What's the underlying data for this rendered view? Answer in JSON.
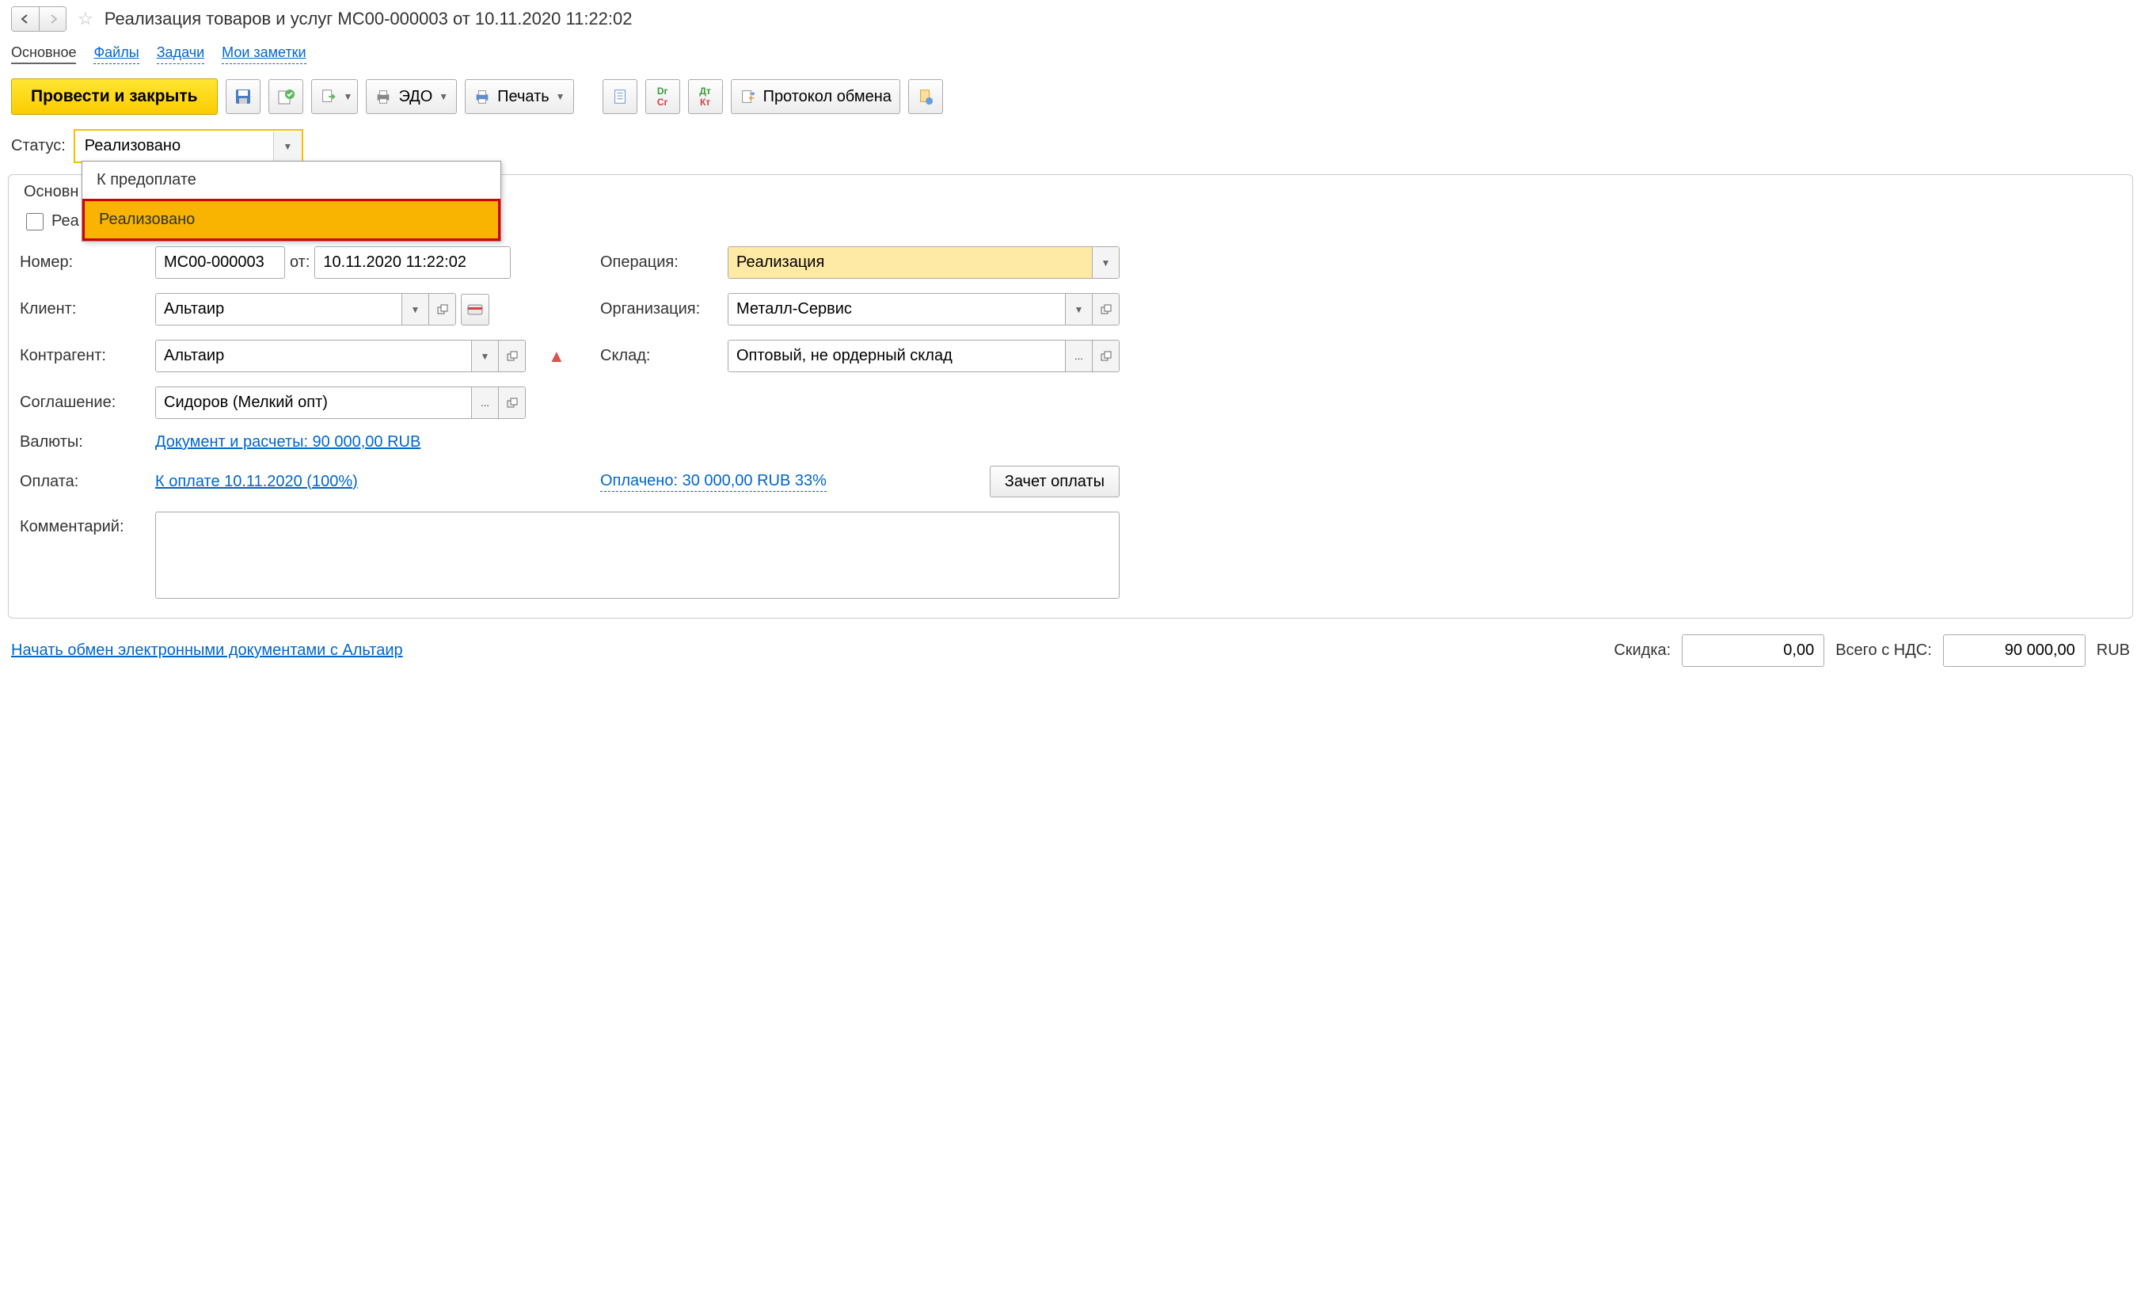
{
  "title": "Реализация товаров и услуг МС00-000003 от 10.11.2020 11:22:02",
  "sections": {
    "main": "Основное",
    "files": "Файлы",
    "tasks": "Задачи",
    "notes": "Мои заметки"
  },
  "toolbar": {
    "mainButton": "Провести и закрыть",
    "edo": "ЭДО",
    "print": "Печать",
    "protocol": "Протокол обмена"
  },
  "status": {
    "label": "Статус:",
    "value": "Реализовано",
    "options": [
      "К предоплате",
      "Реализовано"
    ]
  },
  "panel": {
    "tab": "Основн",
    "checkboxLabel": "Реа"
  },
  "form": {
    "numberLabel": "Номер:",
    "numberValue": "МС00-000003",
    "dateLabel": "от:",
    "dateValue": "10.11.2020 11:22:02",
    "operationLabel": "Операция:",
    "operationValue": "Реализация",
    "clientLabel": "Клиент:",
    "clientValue": "Альтаир",
    "orgLabel": "Организация:",
    "orgValue": "Металл-Сервис",
    "contractorLabel": "Контрагент:",
    "contractorValue": "Альтаир",
    "warehouseLabel": "Склад:",
    "warehouseValue": "Оптовый, не ордерный склад",
    "agreementLabel": "Соглашение:",
    "agreementValue": "Сидоров (Мелкий опт)",
    "currencyLabel": "Валюты:",
    "currencyLink": "Документ и расчеты: 90 000,00 RUB",
    "paymentLabel": "Оплата:",
    "paymentLink": "К оплате 10.11.2020 (100%)",
    "paidLink": "Оплачено: 30 000,00 RUB  33%",
    "paymentOffsetBtn": "Зачет оплаты",
    "commentLabel": "Комментарий:"
  },
  "footer": {
    "edoLink": "Начать обмен электронными документами с Альтаир",
    "discountLabel": "Скидка:",
    "discountValue": "0,00",
    "totalLabel": "Всего с НДС:",
    "totalValue": "90 000,00",
    "currency": "RUB"
  }
}
